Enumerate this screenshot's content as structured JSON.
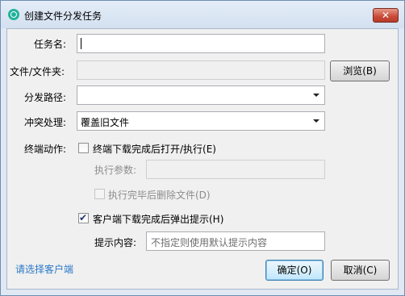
{
  "window": {
    "title": "创建文件分发任务",
    "close_label": "✕",
    "icon": "app-logo-icon"
  },
  "form": {
    "task_name_label": "任务名:",
    "task_name_value": "",
    "file_label": "文件/文件夹:",
    "file_value": "",
    "browse_label": "浏览(B)",
    "path_label": "分发路径:",
    "path_value": "",
    "conflict_label": "冲突处理:",
    "conflict_value": "覆盖旧文件",
    "terminal_action_label": "终端动作:",
    "open_after_download_label": "终端下载完成后打开/执行(E)",
    "open_after_download_checked": false,
    "exec_params_label": "执行参数:",
    "exec_params_value": "",
    "delete_after_exec_label": "执行完毕后删除文件(D)",
    "delete_after_exec_checked": false,
    "popup_hint_label": "客户端下载完成后弹出提示(H)",
    "popup_hint_checked": true,
    "hint_content_label": "提示内容:",
    "hint_content_placeholder": "不指定则使用默认提示内容"
  },
  "footer": {
    "select_client_link": "请选择客户端",
    "ok_label": "确定(O)",
    "cancel_label": "取消(C)"
  },
  "colors": {
    "title_gradient_top": "#e4edf8",
    "close_red": "#c94a36",
    "link_blue": "#2a78c8",
    "default_button_border": "#3c7fb1"
  }
}
